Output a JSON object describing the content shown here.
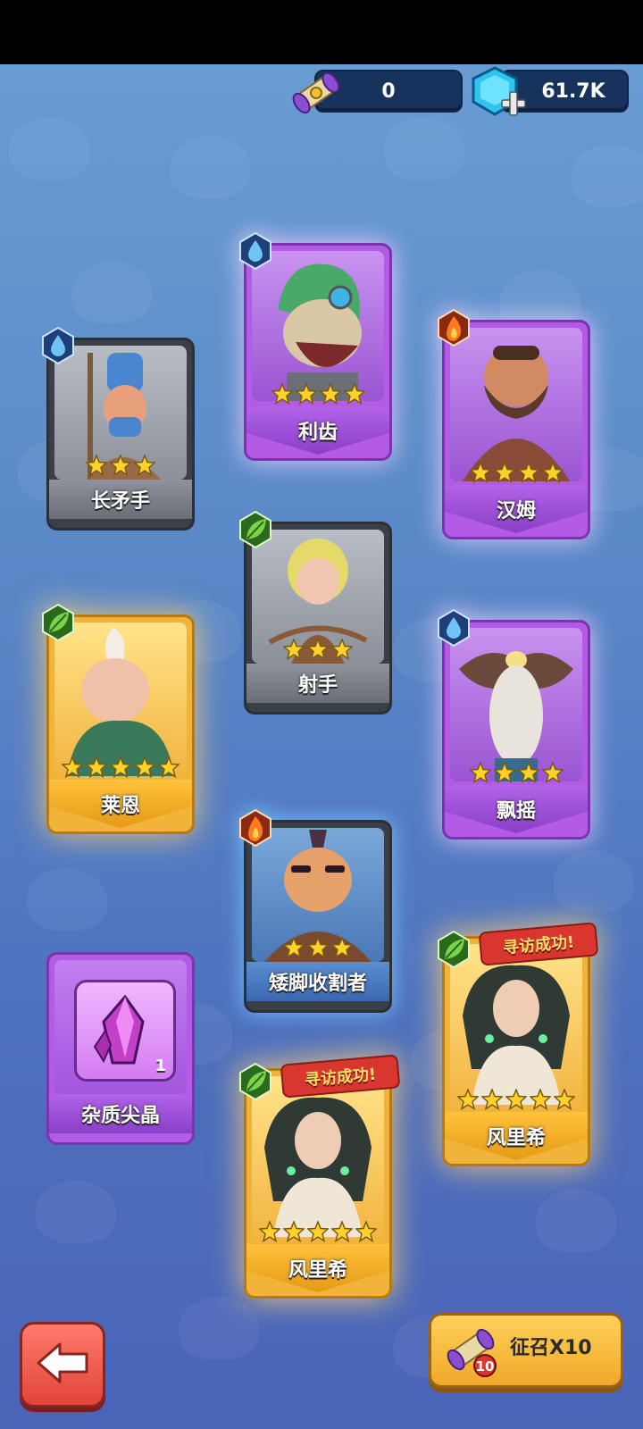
{
  "currency": {
    "scrolls": "0",
    "gems": "61.7K"
  },
  "cards": [
    {
      "name": "长矛手",
      "stars": 3,
      "element": "water",
      "rarity": "gray"
    },
    {
      "name": "利齿",
      "stars": 4,
      "element": "water",
      "rarity": "purple"
    },
    {
      "name": "汉姆",
      "stars": 4,
      "element": "fire",
      "rarity": "purple"
    },
    {
      "name": "射手",
      "stars": 3,
      "element": "leaf",
      "rarity": "gray"
    },
    {
      "name": "莱恩",
      "stars": 5,
      "element": "leaf",
      "rarity": "gold"
    },
    {
      "name": "飘摇",
      "stars": 4,
      "element": "water",
      "rarity": "purple"
    },
    {
      "name": "矮脚收割者",
      "stars": 3,
      "element": "fire",
      "rarity": "blue"
    },
    {
      "name": "杂质尖晶",
      "count": "1",
      "rarity": "purple"
    },
    {
      "name": "风里希",
      "stars": 5,
      "element": "leaf",
      "rarity": "gold",
      "ribbon": "寻访成功!"
    },
    {
      "name": "风里希",
      "stars": 5,
      "element": "leaf",
      "rarity": "gold",
      "ribbon": "寻访成功!"
    }
  ],
  "buttons": {
    "summon_label": "征召X10",
    "summon_badge": "10"
  },
  "icons": [
    "scroll-icon",
    "gem-icon",
    "plus-icon",
    "water-element-icon",
    "fire-element-icon",
    "leaf-element-icon",
    "star-icon",
    "crystal-icon",
    "back-arrow-icon"
  ]
}
